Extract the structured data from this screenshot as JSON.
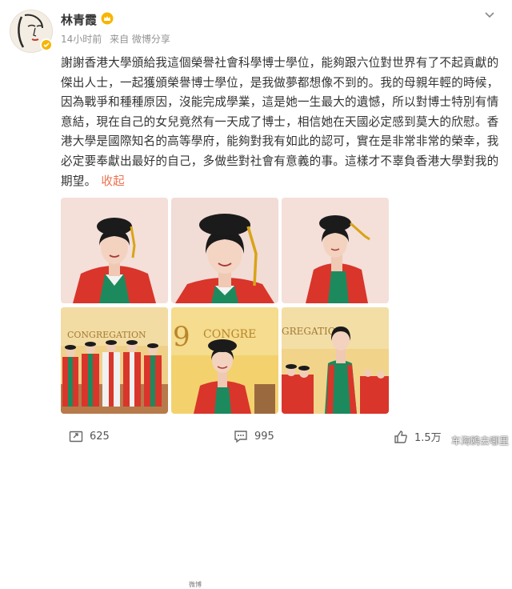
{
  "user": {
    "name": "林青霞",
    "time": "14小时前",
    "source": "来自 微博分享"
  },
  "post": {
    "text": "謝謝香港大學頒給我這個榮譽社會科學博士學位，能夠跟六位對世界有了不起貢獻的傑出人士，一起獲頒榮譽博士學位，是我做夢都想像不到的。我的母親年輕的時候，因為戰爭和種種原因，沒能完成學業，這是她一生最大的遺憾，所以對博士特別有情意結，現在自己的女兒竟然有一天成了博士，相信她在天國必定感到莫大的欣慰。香港大學是國際知名的高等學府，能夠對我有如此的認可，實在是非常非常的榮幸，我必定要奉獻出最好的自己，多做些對社會有意義的事。這樣才不辜負香港大學對我的期望。",
    "collapse_label": "收起"
  },
  "photos": {
    "banner_1": "CONGREGATION",
    "banner_2": "CONGRE",
    "banner_2_num": "9",
    "banner_3": "GREGATION",
    "small_watermark": "微博"
  },
  "footer": {
    "reposts": "625",
    "comments": "995",
    "likes": "1.5万"
  },
  "watermark": "车海鸥去哪里",
  "colors": {
    "accent": "#eb7350",
    "badge": "#f7b500",
    "gown_red": "#d9352b",
    "gown_green": "#1d8a5e"
  }
}
